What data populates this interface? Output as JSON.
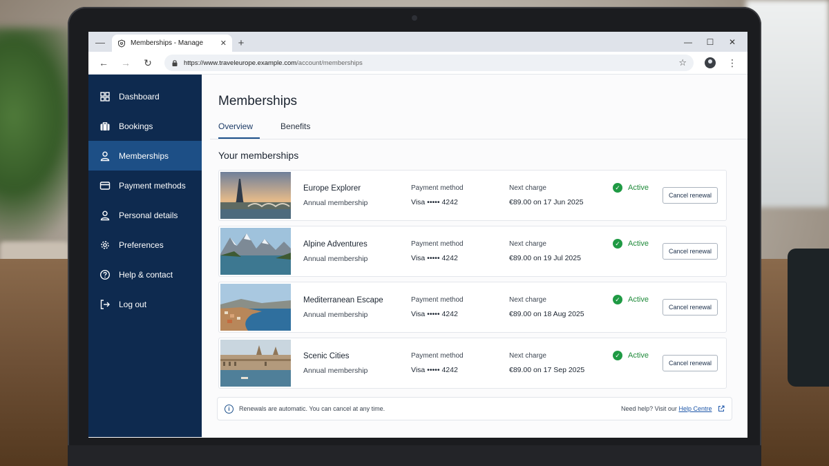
{
  "browser": {
    "tab_title": "Memberships - Manage",
    "url_host": "https://www.traveleurope.example.com",
    "url_path": "/account/memberships"
  },
  "sidebar": {
    "items": [
      {
        "label": "Dashboard",
        "icon": "grid-icon"
      },
      {
        "label": "Bookings",
        "icon": "briefcase-icon"
      },
      {
        "label": "Memberships",
        "icon": "user-icon",
        "active": true
      },
      {
        "label": "Payment methods",
        "icon": "credit-card-icon"
      },
      {
        "label": "Personal details",
        "icon": "user-icon"
      },
      {
        "label": "Preferences",
        "icon": "gear-icon"
      },
      {
        "label": "Help & contact",
        "icon": "help-circle-icon"
      },
      {
        "label": "Log out",
        "icon": "logout-icon"
      }
    ]
  },
  "main": {
    "title": "Memberships",
    "tabs": [
      {
        "label": "Overview",
        "active": true
      },
      {
        "label": "Benefits"
      }
    ],
    "section_title": "Your memberships",
    "payment_label": "Payment method",
    "charge_label": "Next charge",
    "cancel_label": "Cancel renewal",
    "memberships": [
      {
        "name": "Europe Explorer",
        "type": "Annual membership",
        "payment": "Visa ••••• 4242",
        "next_charge": "€89.00 on 17 Jun 2025",
        "status": "Active",
        "image": "paris-eiffel-tower-photo"
      },
      {
        "name": "Alpine Adventures",
        "type": "Annual membership",
        "payment": "Visa ••••• 4242",
        "next_charge": "€89.00 on 19 Jul 2025",
        "status": "Active",
        "image": "alpine-lake-photo"
      },
      {
        "name": "Mediterranean Escape",
        "type": "Annual membership",
        "payment": "Visa ••••• 4242",
        "next_charge": "€89.00 on 18 Aug 2025",
        "status": "Active",
        "image": "coastal-town-photo"
      },
      {
        "name": "Scenic Cities",
        "type": "Annual membership",
        "payment": "Visa ••••• 4242",
        "next_charge": "€89.00 on 17 Sep 2025",
        "status": "Active",
        "image": "riverside-city-photo"
      }
    ],
    "notice": {
      "text": "Renewals are automatic. You can cancel at any time.",
      "help_prefix": "Need help? Visit our",
      "help_link": "Help Centre"
    }
  },
  "colors": {
    "sidebar_bg": "#0e2a4f",
    "sidebar_active": "#1d4f86",
    "status_green": "#1f8a3a",
    "link_blue": "#1b55a8"
  }
}
